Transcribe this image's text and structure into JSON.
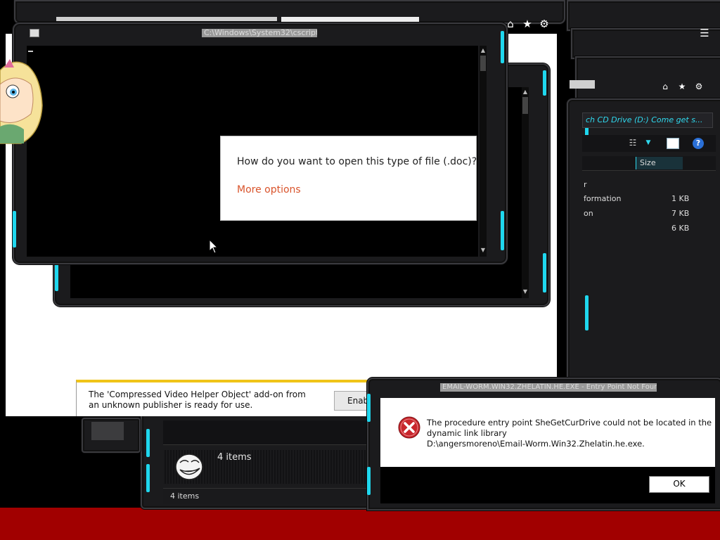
{
  "console_window": {
    "title": "C:\\Windows\\System32\\cscript.exe"
  },
  "open_with_dialog": {
    "question": "How do you want to open this type of file (.doc)?",
    "more_options": "More options"
  },
  "title_toolbar_icons": [
    "home-icon",
    "star-icon",
    "gear-icon"
  ],
  "explorer_window": {
    "address": "ch CD Drive (D:) Come get s...",
    "column_size_header": "Size",
    "rows": [
      {
        "name": "r",
        "size": ""
      },
      {
        "name": "formation",
        "size": "1 KB"
      },
      {
        "name": "on",
        "size": "7 KB"
      },
      {
        "name": "",
        "size": "6 KB"
      }
    ]
  },
  "addon_notification": {
    "message": "The 'Compressed Video Helper Object' add-on from an unknown publisher is ready for use.",
    "enable_label": "Enab"
  },
  "folder_window": {
    "items_count": "4 items",
    "status_items": "4 items"
  },
  "error_dialog": {
    "title": "EMAIL-WORM.WIN32.ZHELATIN.HE.EXE - Entry Point Not Found",
    "message_line1": "The procedure entry point SheGetCurDrive could not be located in the",
    "message_line2": "dynamic link library",
    "message_line3": "D:\\angersmoreno\\Email-Worm.Win32.Zhelatin.he.exe.",
    "ok_label": "OK"
  },
  "colors": {
    "accent_cyan": "#1fd7ee",
    "taskbar_red": "#a10000",
    "more_options_orange": "#d9542c",
    "error_red": "#c8262c"
  }
}
